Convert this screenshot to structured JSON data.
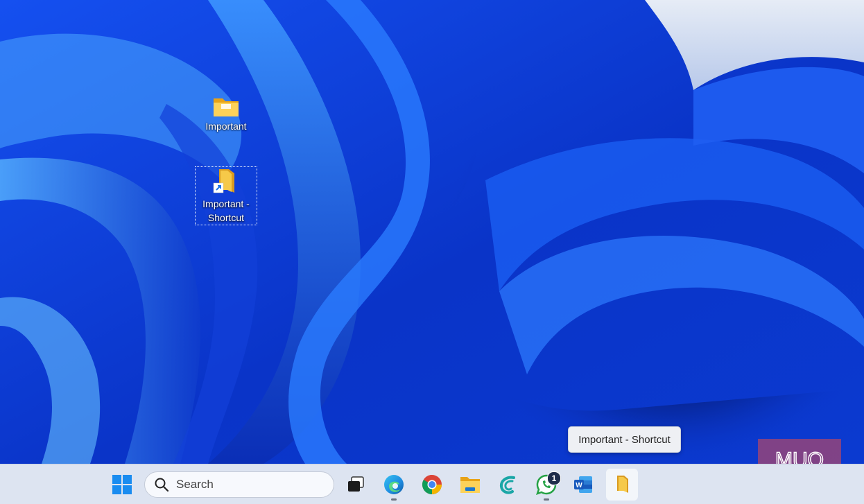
{
  "desktop": {
    "icons": [
      {
        "label": "Important",
        "type": "folder"
      },
      {
        "label": "Important - Shortcut",
        "type": "folder-shortcut",
        "selected": true
      }
    ]
  },
  "taskbar": {
    "search": {
      "placeholder": "Search"
    },
    "apps": [
      {
        "name": "start-button",
        "icon": "windows-logo-icon"
      },
      {
        "name": "task-view",
        "icon": "task-view-icon"
      },
      {
        "name": "edge",
        "icon": "edge-icon",
        "running": true
      },
      {
        "name": "chrome",
        "icon": "chrome-icon"
      },
      {
        "name": "file-explorer",
        "icon": "file-explorer-icon"
      },
      {
        "name": "app-c",
        "icon": "c-logo-icon"
      },
      {
        "name": "whatsapp",
        "icon": "whatsapp-icon",
        "badge": "1",
        "running": true
      },
      {
        "name": "word",
        "icon": "word-icon"
      },
      {
        "name": "important-shortcut",
        "icon": "folder-shortcut-icon",
        "active": true
      }
    ]
  },
  "tooltip": {
    "text": "Important - Shortcut"
  },
  "watermark": {
    "text": "MUO"
  },
  "colors": {
    "taskbar_bg": "#dde4f1",
    "accent_blue": "#0078d4",
    "wallpaper_deep": "#02124a",
    "wallpaper_bright": "#2f8dff"
  }
}
